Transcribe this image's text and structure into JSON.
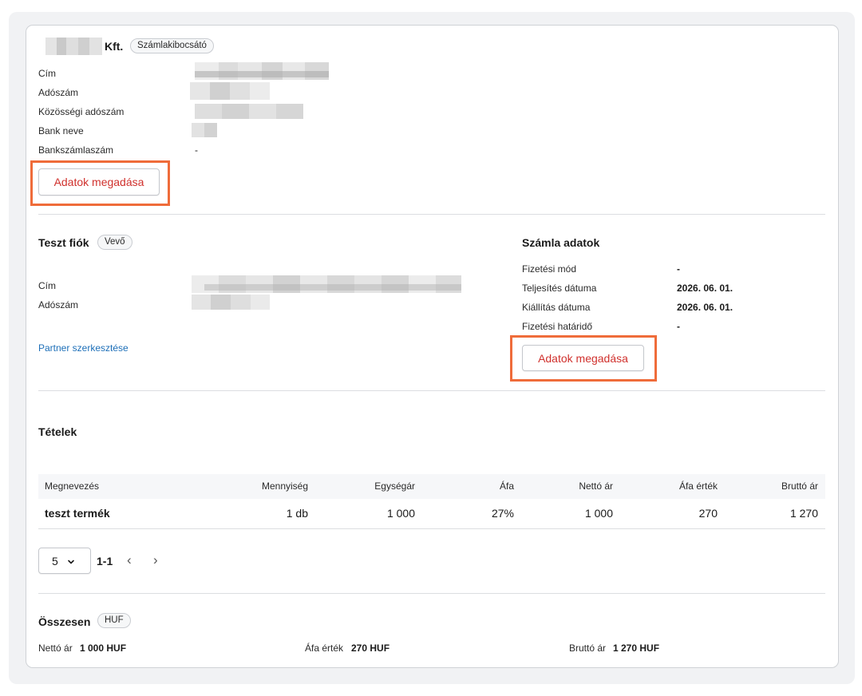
{
  "issuer": {
    "name_suffix": "Kft.",
    "role_badge": "Számlakibocsátó",
    "fields": [
      {
        "label": "Cím",
        "value": ""
      },
      {
        "label": "Adószám",
        "value": ""
      },
      {
        "label": "Közösségi adószám",
        "value": ""
      },
      {
        "label": "Bank neve",
        "value": ""
      },
      {
        "label": "Bankszámlaszám",
        "value": "-"
      }
    ],
    "edit_button": "Adatok megadása"
  },
  "buyer": {
    "name": "Teszt fiók",
    "role_badge": "Vevő",
    "fields": [
      {
        "label": "Cím",
        "value": ""
      },
      {
        "label": "Adószám",
        "value": ""
      }
    ],
    "edit_link": "Partner szerkesztése"
  },
  "invoice": {
    "title": "Számla adatok",
    "fields": [
      {
        "label": "Fizetési mód",
        "value": "-"
      },
      {
        "label": "Teljesítés dátuma",
        "value": "2026. 06. 01."
      },
      {
        "label": "Kiállítás dátuma",
        "value": "2026. 06. 01."
      },
      {
        "label": "Fizetési határidő",
        "value": "-"
      }
    ],
    "edit_button": "Adatok megadása"
  },
  "items": {
    "title": "Tételek",
    "columns": [
      "Megnevezés",
      "Mennyiség",
      "Egységár",
      "Áfa",
      "Nettó ár",
      "Áfa érték",
      "Bruttó ár"
    ],
    "rows": [
      [
        "teszt termék",
        "1 db",
        "1 000",
        "27%",
        "1 000",
        "270",
        "1 270"
      ]
    ],
    "pagination": {
      "page_size": "5",
      "range": "1-1",
      "prev": "‹",
      "next": "›"
    }
  },
  "totals": {
    "title": "Összesen",
    "currency_badge": "HUF",
    "net_label": "Nettó ár",
    "net_value": "1 000 HUF",
    "vat_label": "Áfa érték",
    "vat_value": "270 HUF",
    "gross_label": "Bruttó ár",
    "gross_value": "1 270 HUF"
  },
  "colors": {
    "accent_text": "#d0312d",
    "highlight": "#ef6c3a",
    "link": "#1d6fb8"
  }
}
